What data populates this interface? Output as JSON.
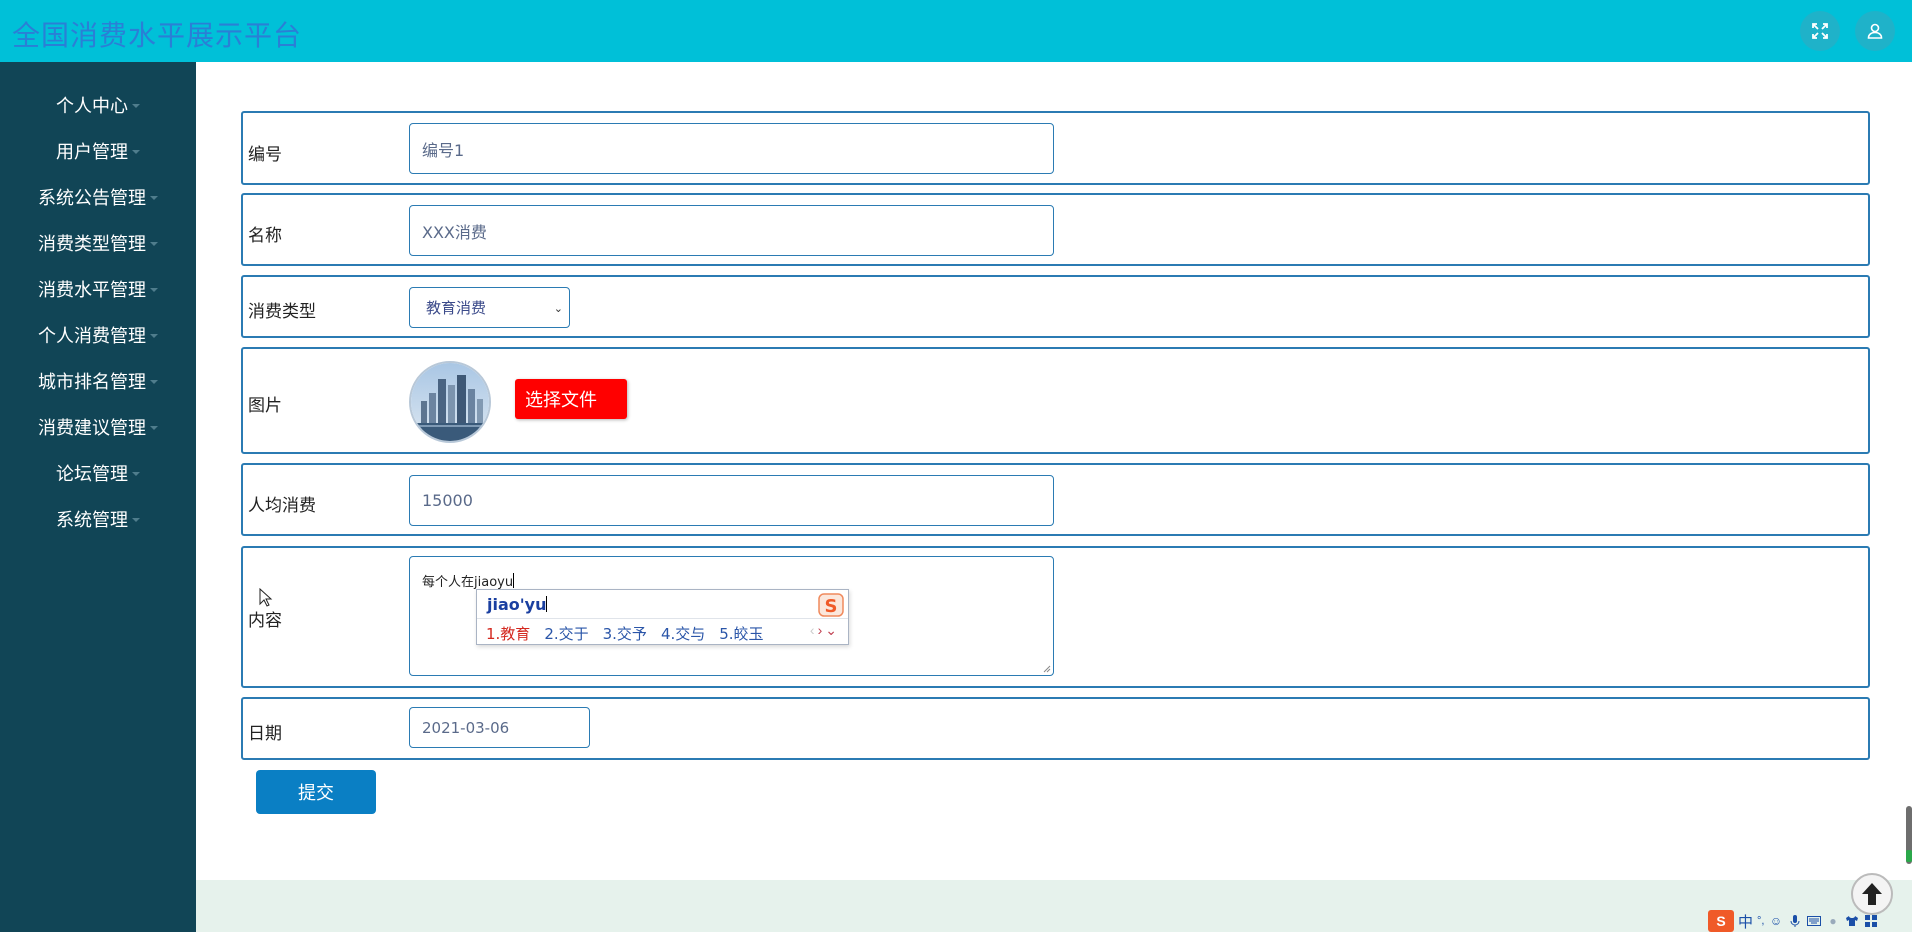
{
  "app": {
    "title": "全国消费水平展示平台"
  },
  "header": {
    "icons": [
      "fullscreen-icon",
      "user-icon"
    ]
  },
  "sidebar": {
    "items": [
      {
        "label": "个人中心"
      },
      {
        "label": "用户管理"
      },
      {
        "label": "系统公告管理"
      },
      {
        "label": "消费类型管理"
      },
      {
        "label": "消费水平管理"
      },
      {
        "label": "个人消费管理"
      },
      {
        "label": "城市排名管理"
      },
      {
        "label": "消费建议管理"
      },
      {
        "label": "论坛管理"
      },
      {
        "label": "系统管理"
      }
    ]
  },
  "form": {
    "code": {
      "label": "编号",
      "value": "编号1"
    },
    "name": {
      "label": "名称",
      "value": "XXX消费"
    },
    "category": {
      "label": "消费类型",
      "selected": "教育消费"
    },
    "image": {
      "label": "图片",
      "button_label": "选择文件"
    },
    "per_capita": {
      "label": "人均消费",
      "value": "15000"
    },
    "content": {
      "label": "内容",
      "typed_text": "每个人在",
      "composing_text": "jiaoyu"
    },
    "date": {
      "label": "日期",
      "value": "2021-03-06"
    },
    "submit_label": "提交"
  },
  "ime": {
    "composition": "jiao'yu",
    "candidates": [
      "1.教育",
      "2.交于",
      "3.交予",
      "4.交与",
      "5.皎玉"
    ],
    "toolbar_mode": "中",
    "toolbar_punct": "°,"
  },
  "colors": {
    "topbar": "#00c0d8",
    "sidebar": "#114556",
    "accent_border": "#2b7bb3",
    "file_button": "#ff0000",
    "submit_button": "#0a7fc4"
  }
}
